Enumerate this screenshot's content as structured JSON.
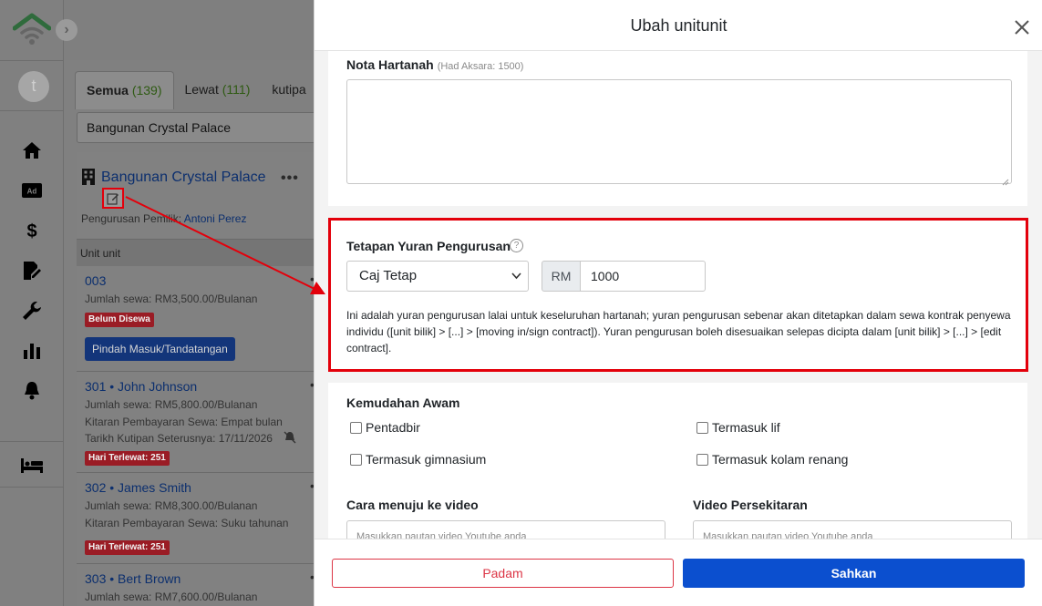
{
  "sidebar": {
    "expand_icon": "chevron-right-icon",
    "avatar_initial": "t",
    "nav_icons": [
      "home-icon",
      "ad-icon",
      "dollar-icon",
      "contract-edit-icon",
      "wrench-icon",
      "bar-chart-icon",
      "bell-icon",
      "bed-icon"
    ]
  },
  "list": {
    "tabs": [
      {
        "label": "Semua",
        "count": "(139)"
      },
      {
        "label": "Lewat",
        "count": "(111)"
      },
      {
        "label": "kutipa",
        "count": ""
      }
    ],
    "filter_value": "Bangunan Crystal Palace",
    "building": {
      "name": "Bangunan Crystal Palace",
      "more": "•••",
      "manager_label": "Pengurusan Pemilik:",
      "manager_name": "Antoni Perez"
    },
    "units_header": "Unit unit",
    "units": [
      {
        "title": "003",
        "rent": "Jumlah sewa: RM3,500.00/Bulanan",
        "badge": "Belum Disewa",
        "button": "Pindah Masuk/Tandatangan"
      },
      {
        "title": "301 • John Johnson",
        "rent": "Jumlah sewa: RM5,800.00/Bulanan",
        "cycle": "Kitaran Pembayaran Sewa: Empat bulan",
        "next": "Tarikh Kutipan Seterusnya:  17/11/2026",
        "badge": "Hari Terlewat: 251"
      },
      {
        "title": "302 • James Smith",
        "rent": "Jumlah sewa: RM8,300.00/Bulanan",
        "cycle": "Kitaran Pembayaran Sewa: Suku tahunan",
        "badge": "Hari Terlewat: 251"
      },
      {
        "title": "303 • Bert Brown",
        "rent": "Jumlah sewa: RM7,600.00/Bulanan"
      }
    ]
  },
  "modal": {
    "title": "Ubah unitunit",
    "note": {
      "label": "Nota Hartanah",
      "hint": "(Had Aksara: 1500)",
      "value": ""
    },
    "fee": {
      "label": "Tetapan Yuran Pengurusan",
      "help": "?",
      "select_value": "Caj Tetap",
      "currency": "RM",
      "amount": "1000",
      "description": "Ini adalah yuran pengurusan lalai untuk keseluruhan hartanah; yuran pengurusan sebenar akan ditetapkan dalam sewa kontrak penyewa individu ([unit bilik] > [...] > [moving in/sign contract]). Yuran pengurusan boleh disesuaikan selepas dicipta dalam [unit bilik] > [...] > [edit contract]."
    },
    "amenities": {
      "label": "Kemudahan Awam",
      "items": [
        "Pentadbir",
        "Termasuk lif",
        "Termasuk gimnasium",
        "Termasuk kolam renang"
      ]
    },
    "video_route": {
      "label": "Cara menuju ke video",
      "placeholder": "Masukkan pautan video Youtube anda"
    },
    "video_area": {
      "label": "Video Persekitaran",
      "placeholder": "Masukkan pautan video Youtube anda"
    },
    "cancel_label": "Padam",
    "save_label": "Sahkan"
  },
  "colors": {
    "highlight": "#e3000b",
    "primary": "#0b4fcf",
    "danger": "#dc3545"
  }
}
